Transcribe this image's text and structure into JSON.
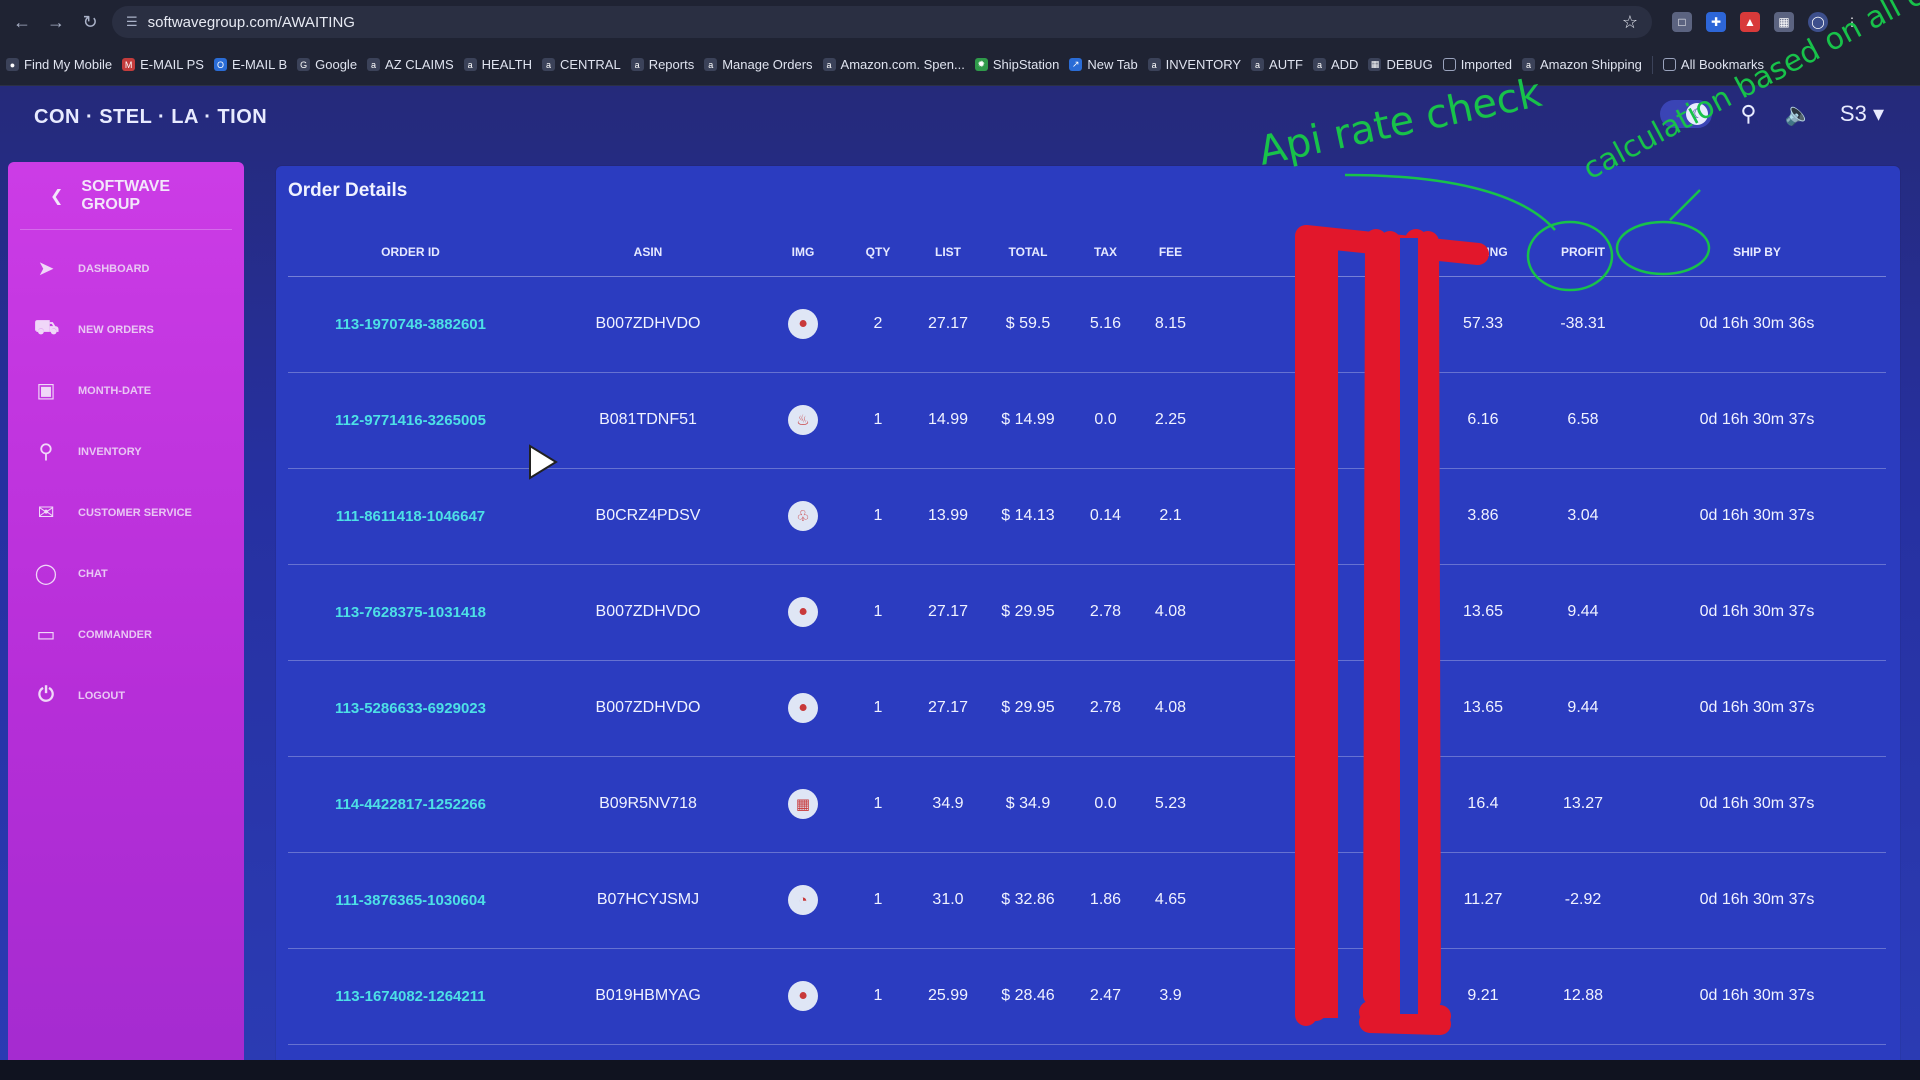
{
  "browser": {
    "url": "softwavegroup.com/AWAITING",
    "bookmarks": [
      "Find My Mobile",
      "E-MAIL PS",
      "E-MAIL B",
      "Google",
      "AZ CLAIMS",
      "HEALTH",
      "CENTRAL",
      "Reports",
      "Manage Orders",
      "Amazon.com. Spen...",
      "ShipStation",
      "New Tab",
      "INVENTORY",
      "AUTF",
      "ADD",
      "DEBUG",
      "Imported",
      "Amazon Shipping"
    ],
    "all_bookmarks": "All Bookmarks"
  },
  "app": {
    "brand": "CON · STEL · LA · TION",
    "user_menu": "S3"
  },
  "sidebar": {
    "header": "SOFTWAVE GROUP",
    "items": [
      {
        "label": "DASHBOARD",
        "icon": "rocket-icon"
      },
      {
        "label": "NEW ORDERS",
        "icon": "truck-icon"
      },
      {
        "label": "MONTH-DATE",
        "icon": "calendar-icon"
      },
      {
        "label": "INVENTORY",
        "icon": "search-icon"
      },
      {
        "label": "CUSTOMER SERVICE",
        "icon": "mail-icon"
      },
      {
        "label": "CHAT",
        "icon": "chat-icon"
      },
      {
        "label": "COMMANDER",
        "icon": "monitor-icon"
      },
      {
        "label": "LOGOUT",
        "icon": "power-icon"
      }
    ]
  },
  "order_details": {
    "title": "Order Details",
    "columns": [
      "ORDER ID",
      "ASIN",
      "IMG",
      "QTY",
      "LIST",
      "TOTAL",
      "TAX",
      "FEE",
      "",
      "",
      "SHIPING",
      "PROFIT",
      "SHIP BY"
    ],
    "rows": [
      {
        "order_id": "113-1970748-3882601",
        "asin": "B007ZDHVDO",
        "qty": "2",
        "list": "27.17",
        "total": "$ 59.5",
        "tax": "5.16",
        "fee": "8.15",
        "shipping": "57.33",
        "profit": "-38.31",
        "ship_by": "0d 16h 30m 36s"
      },
      {
        "order_id": "112-9771416-3265005",
        "asin": "B081TDNF51",
        "qty": "1",
        "list": "14.99",
        "total": "$ 14.99",
        "tax": "0.0",
        "fee": "2.25",
        "shipping": "6.16",
        "profit": "6.58",
        "ship_by": "0d 16h 30m 37s"
      },
      {
        "order_id": "111-8611418-1046647",
        "asin": "B0CRZ4PDSV",
        "qty": "1",
        "list": "13.99",
        "total": "$ 14.13",
        "tax": "0.14",
        "fee": "2.1",
        "shipping": "3.86",
        "profit": "3.04",
        "ship_by": "0d 16h 30m 37s"
      },
      {
        "order_id": "113-7628375-1031418",
        "asin": "B007ZDHVDO",
        "qty": "1",
        "list": "27.17",
        "total": "$ 29.95",
        "tax": "2.78",
        "fee": "4.08",
        "shipping": "13.65",
        "profit": "9.44",
        "ship_by": "0d 16h 30m 37s"
      },
      {
        "order_id": "113-5286633-6929023",
        "asin": "B007ZDHVDO",
        "qty": "1",
        "list": "27.17",
        "total": "$ 29.95",
        "tax": "2.78",
        "fee": "4.08",
        "shipping": "13.65",
        "profit": "9.44",
        "ship_by": "0d 16h 30m 37s"
      },
      {
        "order_id": "114-4422817-1252266",
        "asin": "B09R5NV718",
        "qty": "1",
        "list": "34.9",
        "total": "$ 34.9",
        "tax": "0.0",
        "fee": "5.23",
        "shipping": "16.4",
        "profit": "13.27",
        "ship_by": "0d 16h 30m 37s"
      },
      {
        "order_id": "111-3876365-1030604",
        "asin": "B07HCYJSMJ",
        "qty": "1",
        "list": "31.0",
        "total": "$ 32.86",
        "tax": "1.86",
        "fee": "4.65",
        "shipping": "11.27",
        "profit": "-2.92",
        "ship_by": "0d 16h 30m 37s"
      },
      {
        "order_id": "113-1674082-1264211",
        "asin": "B019HBMYAG",
        "qty": "1",
        "list": "25.99",
        "total": "$ 28.46",
        "tax": "2.47",
        "fee": "3.9",
        "shipping": "9.21",
        "profit": "12.88",
        "ship_by": "0d 16h 30m 37s"
      }
    ]
  },
  "annotations": {
    "note_1": "Api rate check",
    "note_2": "calculation based on all cost",
    "color": "#18c24a",
    "redaction_color": "#e2172b"
  }
}
